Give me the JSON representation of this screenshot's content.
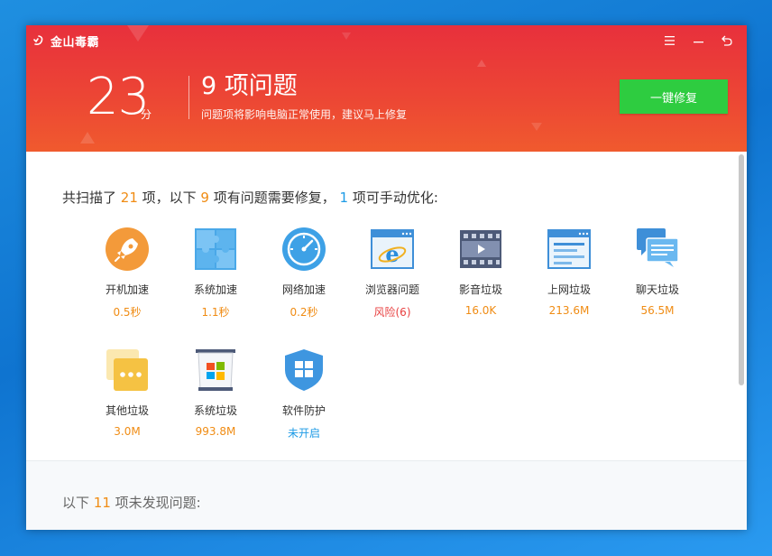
{
  "app": {
    "title": "金山毒霸"
  },
  "window_controls": [
    {
      "name": "menu",
      "icon": "menu-icon",
      "glyph": "☰"
    },
    {
      "name": "minimize",
      "icon": "minimize-icon",
      "glyph": "—"
    },
    {
      "name": "back",
      "icon": "back-icon",
      "glyph": "↶"
    }
  ],
  "score": {
    "value": "23",
    "unit": "分"
  },
  "issues": {
    "title": "9 项问题",
    "subtitle": "问题项将影响电脑正常使用，建议马上修复"
  },
  "fix_button": {
    "label": "一键修复"
  },
  "summary": {
    "part1": "共扫描了 ",
    "scanned": "21",
    "part2": " 项，以下 ",
    "problems": "9",
    "part3": " 项有问题需要修复， ",
    "manual": "1",
    "part4": " 项可手动优化:"
  },
  "items": [
    {
      "id": "boot-speed",
      "label": "开机加速",
      "value": "0.5秒",
      "icon": "rocket-icon"
    },
    {
      "id": "system-speed",
      "label": "系统加速",
      "value": "1.1秒",
      "icon": "puzzle-icon"
    },
    {
      "id": "network-speed",
      "label": "网络加速",
      "value": "0.2秒",
      "icon": "speedometer-icon"
    },
    {
      "id": "browser-issue",
      "label": "浏览器问题",
      "value": "风险(6)",
      "icon": "ie-browser-icon"
    },
    {
      "id": "media-junk",
      "label": "影音垃圾",
      "value": "16.0K",
      "icon": "film-icon"
    },
    {
      "id": "web-junk",
      "label": "上网垃圾",
      "value": "213.6M",
      "icon": "webpage-icon"
    },
    {
      "id": "chat-junk",
      "label": "聊天垃圾",
      "value": "56.5M",
      "icon": "chat-icon"
    },
    {
      "id": "other-junk",
      "label": "其他垃圾",
      "value": "3.0M",
      "icon": "other-icon"
    },
    {
      "id": "system-junk",
      "label": "系统垃圾",
      "value": "993.8M",
      "icon": "trash-icon"
    },
    {
      "id": "software-protect",
      "label": "软件防护",
      "value": "未开启",
      "icon": "shield-icon"
    }
  ],
  "footer": {
    "part1": "以下 ",
    "count": "11",
    "part2": " 项未发现问题:"
  },
  "colors": {
    "header_top": "#e8303c",
    "header_bottom": "#f05a2e",
    "fix_button": "#2ecc40",
    "accent_orange": "#f08c14",
    "accent_blue": "#1e9be6",
    "risk_red": "#e84040"
  }
}
